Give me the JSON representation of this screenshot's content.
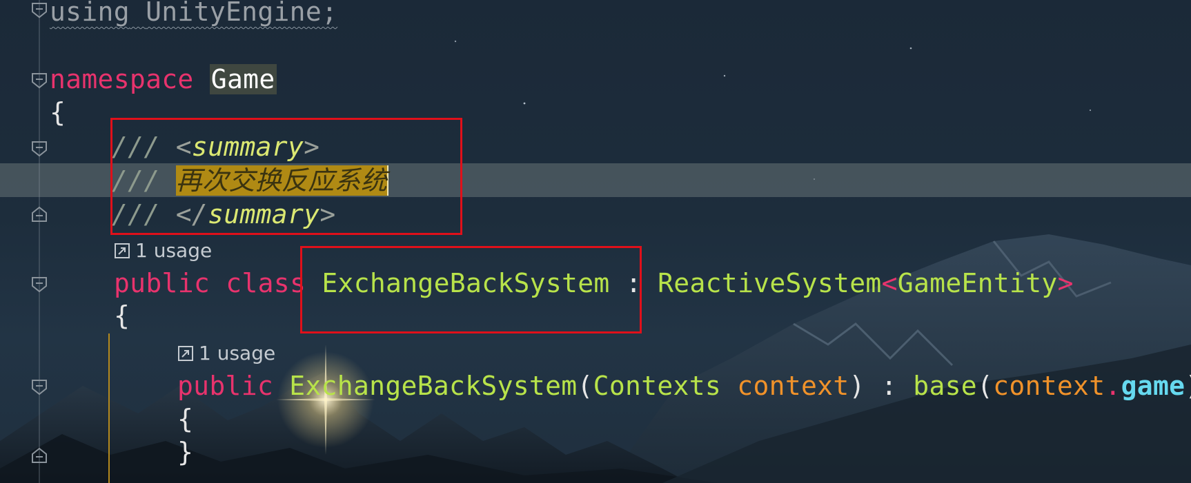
{
  "code": {
    "line_using": {
      "keyword": "using",
      "space": " ",
      "name": "UnityEngine;"
    },
    "line_namespace": {
      "keyword": "namespace",
      "space": " ",
      "name": "Game"
    },
    "line_open_brace_1": "{",
    "line_summary_open": {
      "slashes": "///",
      "space": " ",
      "lt": "<",
      "tag": "summary",
      "gt": ">"
    },
    "line_summary_text": {
      "slashes": "///",
      "space": " ",
      "text": "再次交换反应系统"
    },
    "line_summary_close": {
      "slashes": "///",
      "space": " ",
      "lt": "</",
      "tag": "summary",
      "gt": ">"
    },
    "usage_hint_1": "1 usage",
    "line_class": {
      "public": "public",
      "space1": " ",
      "class": "class",
      "space2": " ",
      "name": "ExchangeBackSystem",
      "colon": " : ",
      "base": "ReactiveSystem",
      "lt": "<",
      "generic": "GameEntity",
      "gt": ">"
    },
    "line_open_brace_2": "{",
    "usage_hint_2": "1 usage",
    "line_ctor": {
      "public": "public",
      "space1": " ",
      "name": "ExchangeBackSystem",
      "paren_open": "(",
      "param_type": "Contexts",
      "space2": " ",
      "param_name": "context",
      "paren_close": ")",
      "colon": " : ",
      "base": "base",
      "paren_open2": "(",
      "arg": "context",
      "dot": ".",
      "field": "game",
      "paren_close2": ")"
    },
    "line_open_brace_3": "{",
    "line_close_brace_3": "}"
  },
  "icons": {
    "fold": "fold-toggle-icon",
    "usage": "go-to-usage-icon"
  },
  "colors": {
    "keyword": "#e8336d",
    "type": "#a6e22e",
    "comment": "#8d9a8d",
    "parameter": "#f0922a",
    "field": "#66d9ef",
    "highlight_box": "#e0101a"
  }
}
